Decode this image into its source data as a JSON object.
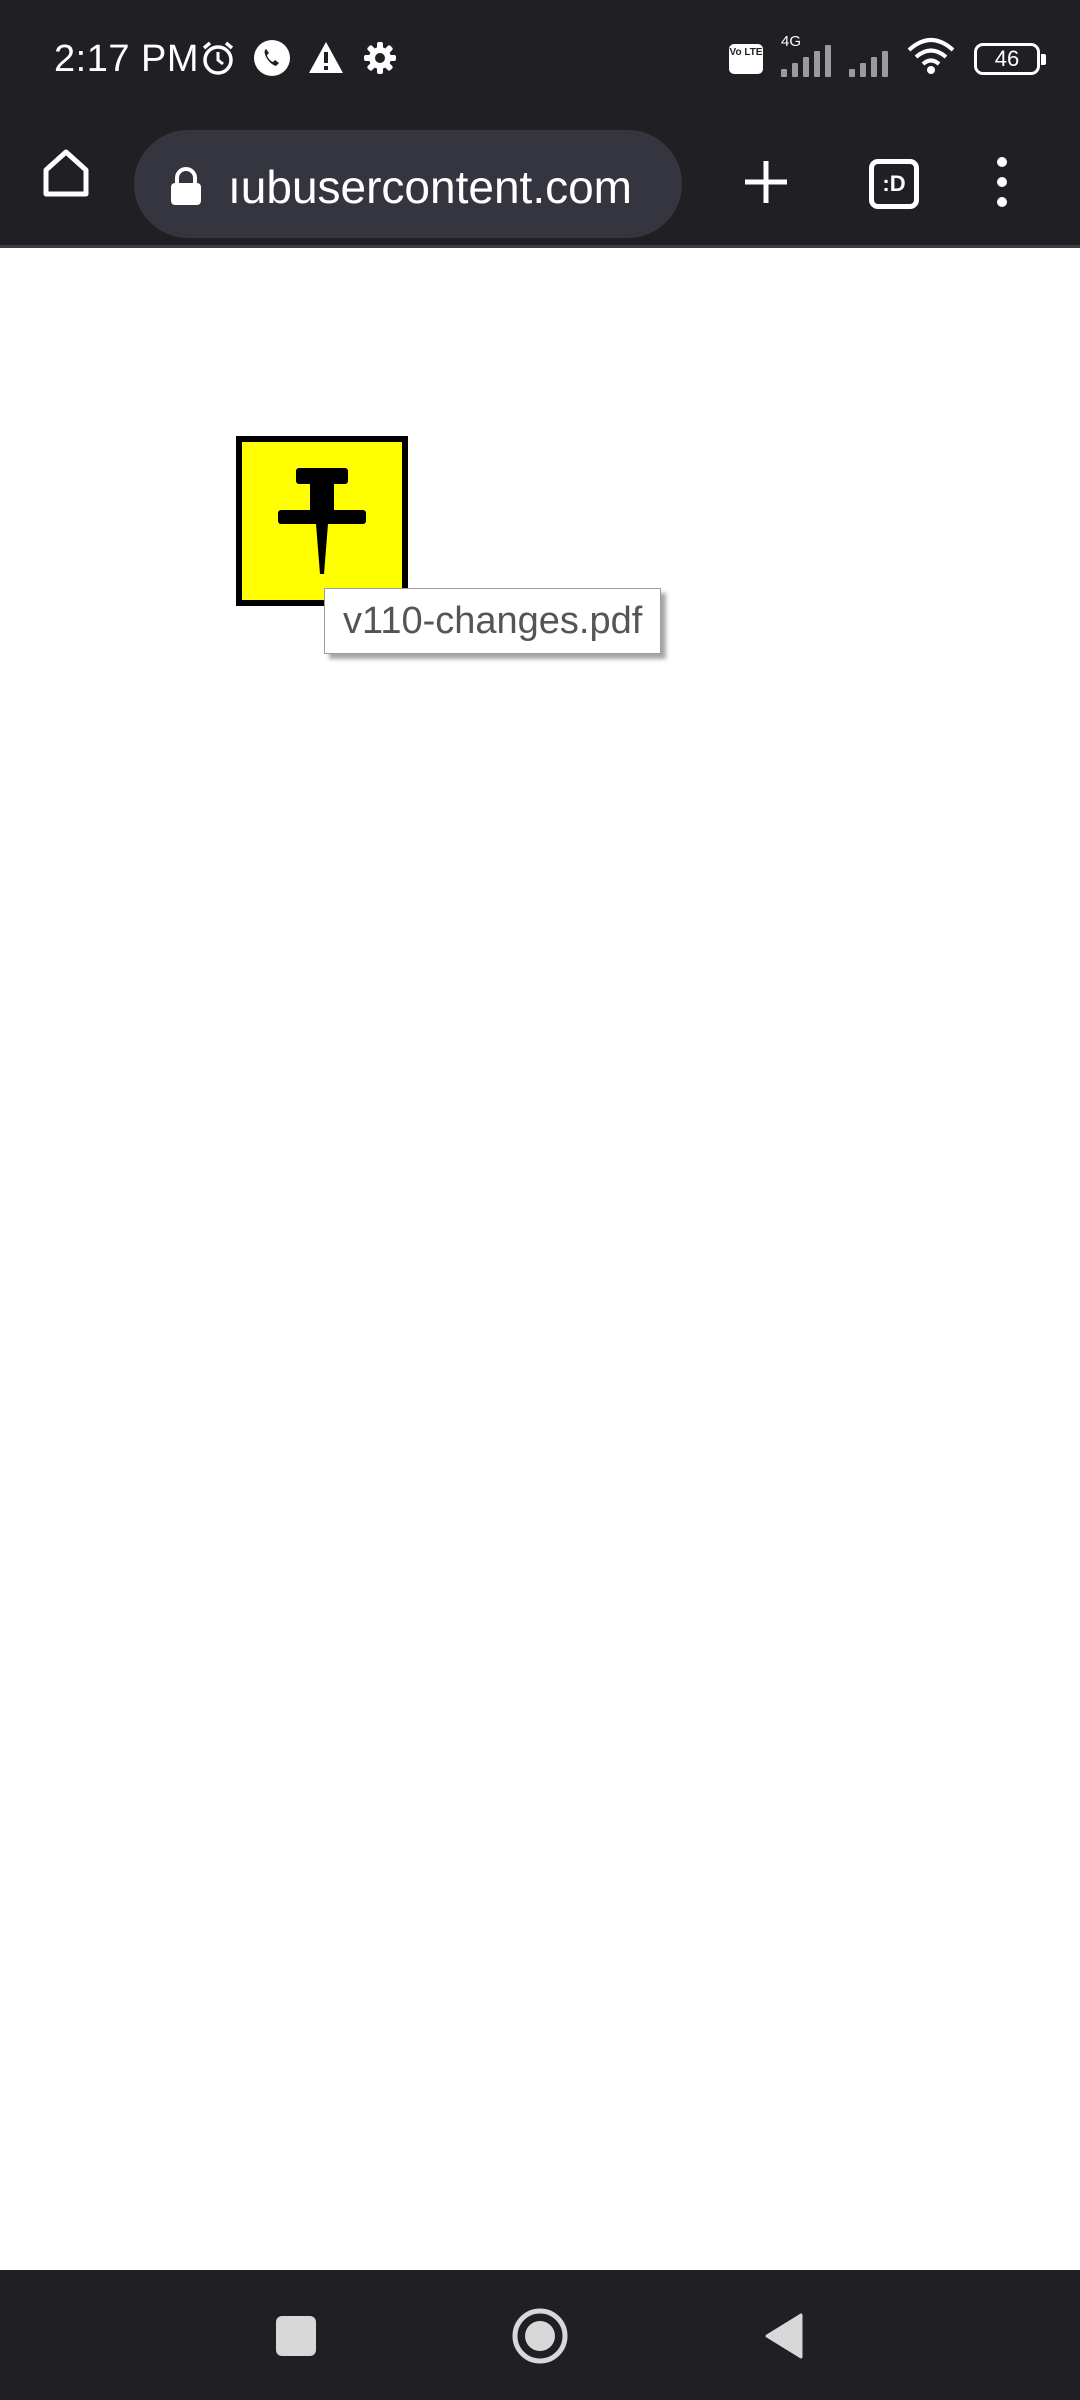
{
  "status_bar": {
    "time": "2:17 PM",
    "left_icons": [
      "alarm-icon",
      "call-icon",
      "warning-icon",
      "settings-gear-icon"
    ],
    "volte_label": "Vo LTE",
    "network_label": "4G",
    "battery_level": "46"
  },
  "browser": {
    "url": "githubusercontent.com",
    "url_visible": "ıubusercontent.com",
    "tabs_label": ":D"
  },
  "content": {
    "file_icon": "pushpin-icon",
    "icon_color": "#ffff00",
    "tooltip": "v110-changes.pdf"
  },
  "colors": {
    "chrome_background": "#1f1f24",
    "omnibox_background": "#35353f",
    "page_background": "#ffffff"
  }
}
